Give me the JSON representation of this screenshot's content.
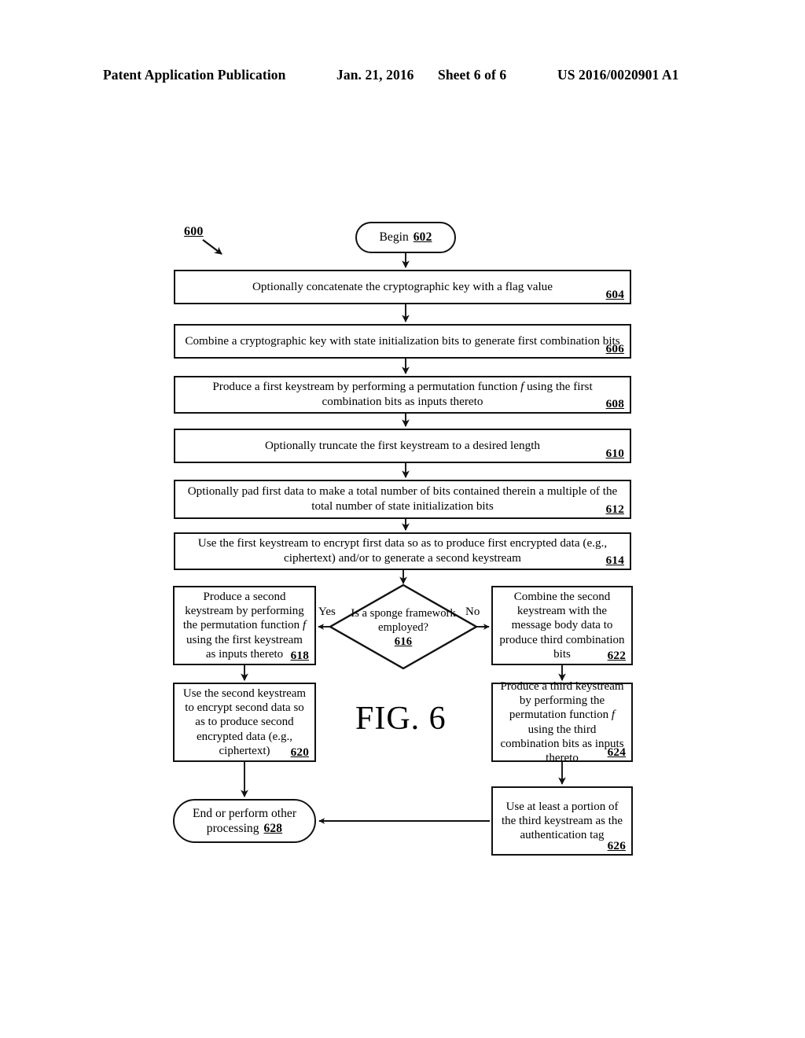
{
  "header": {
    "publication": "Patent Application Publication",
    "date": "Jan. 21, 2016",
    "sheet": "Sheet 6 of 6",
    "patent_number": "US 2016/0020901 A1"
  },
  "figure": {
    "label": "FIG. 6",
    "diagram_ref": "600",
    "type": "flowchart"
  },
  "labels": {
    "yes": "Yes",
    "no": "No"
  },
  "nodes": {
    "n602": {
      "ref": "602",
      "shape": "terminal",
      "text": "Begin"
    },
    "n604": {
      "ref": "604",
      "shape": "process",
      "text": "Optionally concatenate the cryptographic key with a flag value"
    },
    "n606": {
      "ref": "606",
      "shape": "process",
      "text": "Combine a cryptographic key with state initialization bits to generate first combination bits"
    },
    "n608": {
      "ref": "608",
      "shape": "process",
      "text_a": "Produce a first keystream by performing a permutation function ",
      "text_f": "f",
      "text_b": " using the first combination bits as inputs thereto"
    },
    "n610": {
      "ref": "610",
      "shape": "process",
      "text": "Optionally truncate the first keystream to a desired length"
    },
    "n612": {
      "ref": "612",
      "shape": "process",
      "text": "Optionally pad first data to make a total number of bits contained therein a multiple of the total number of state initialization bits"
    },
    "n614": {
      "ref": "614",
      "shape": "process",
      "text": "Use the first keystream to encrypt first data so as to produce first encrypted data (e.g., ciphertext) and/or to generate a second keystream"
    },
    "n616": {
      "ref": "616",
      "shape": "decision",
      "text": "Is a sponge framework employed?"
    },
    "n618": {
      "ref": "618",
      "shape": "process",
      "text_a": "Produce a second keystream by performing the permutation function ",
      "text_f": "f",
      "text_b": " using the first keystream as inputs thereto"
    },
    "n620": {
      "ref": "620",
      "shape": "process",
      "text": "Use the second keystream to encrypt second data so as to produce second encrypted data (e.g., ciphertext)"
    },
    "n622": {
      "ref": "622",
      "shape": "process",
      "text": "Combine the second keystream with the message body data to produce third combination bits"
    },
    "n624": {
      "ref": "624",
      "shape": "process",
      "text_a": "Produce a third keystream by performing the permutation function ",
      "text_f": "f",
      "text_b": " using the third combination bits as inputs thereto"
    },
    "n626": {
      "ref": "626",
      "shape": "process",
      "text": "Use at least a portion of the third keystream as the authentication tag"
    },
    "n628": {
      "ref": "628",
      "shape": "terminal",
      "text": "End or perform other processing"
    }
  },
  "colors": {
    "ink": "#111111",
    "page": "#ffffff"
  }
}
